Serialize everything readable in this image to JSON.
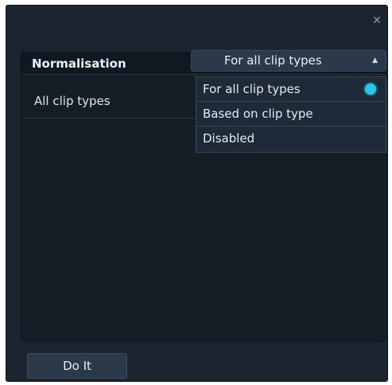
{
  "dialog": {
    "close_icon": "close-icon"
  },
  "table": {
    "header": "Normalisation",
    "rows": [
      {
        "label": "All clip types"
      }
    ]
  },
  "combo": {
    "value": "For all clip types",
    "arrow_icon": "triangle-up-icon"
  },
  "dropdown": {
    "options": [
      {
        "label": "For all clip types",
        "selected": true
      },
      {
        "label": "Based on clip type",
        "selected": false
      },
      {
        "label": "Disabled",
        "selected": false
      }
    ],
    "selected_color": "#26c6ef"
  },
  "footer": {
    "do_it_label": "Do It"
  }
}
